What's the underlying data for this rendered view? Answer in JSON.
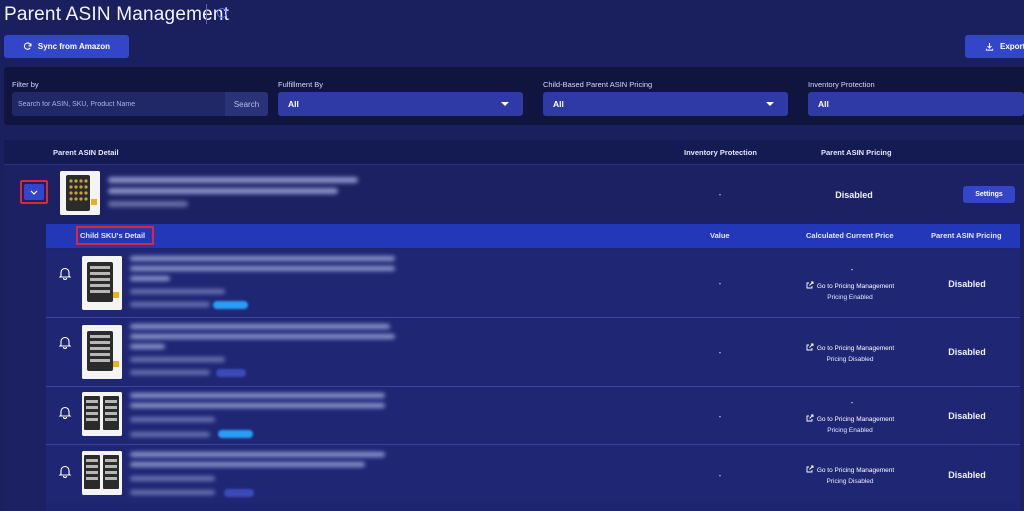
{
  "header": {
    "title": "Parent ASIN Management",
    "sync_label": "Sync from Amazon",
    "export_label": "Export"
  },
  "filters": {
    "filter_by_label": "Filter by",
    "search_placeholder": "Search for ASIN, SKU, Product Name",
    "search_button": "Search",
    "fulfillment_label": "Fulfillment By",
    "fulfillment_value": "All",
    "child_pricing_label": "Child-Based Parent ASIN Pricing",
    "child_pricing_value": "All",
    "inventory_label": "Inventory Protection",
    "inventory_value": "All"
  },
  "table": {
    "headers": {
      "detail": "Parent ASIN Detail",
      "inventory": "Inventory Protection",
      "pricing": "Parent ASIN Pricing"
    },
    "parent_row": {
      "inventory": "-",
      "pricing": "Disabled",
      "settings": "Settings"
    }
  },
  "child_table": {
    "headers": {
      "detail": "Child SKU's Detail",
      "value": "Value",
      "calc_price": "Calculated Current Price",
      "pricing": "Parent ASIN Pricing"
    },
    "rows": [
      {
        "value": "-",
        "price": "-",
        "link": "Go to Pricing Management",
        "status": "Pricing Enabled",
        "pricing": "Disabled"
      },
      {
        "value": "-",
        "price": "",
        "link": "Go to Pricing Management",
        "status": "Pricing Disabled",
        "pricing": "Disabled"
      },
      {
        "value": "-",
        "price": "-",
        "link": "Go to Pricing Management",
        "status": "Pricing Enabled",
        "pricing": "Disabled"
      },
      {
        "value": "-",
        "price": "",
        "link": "Go to Pricing Management",
        "status": "Pricing Disabled",
        "pricing": "Disabled"
      }
    ]
  },
  "colors": {
    "background": "#1a1f5e",
    "accent": "#3346c9",
    "highlight_box": "#e0262e"
  }
}
